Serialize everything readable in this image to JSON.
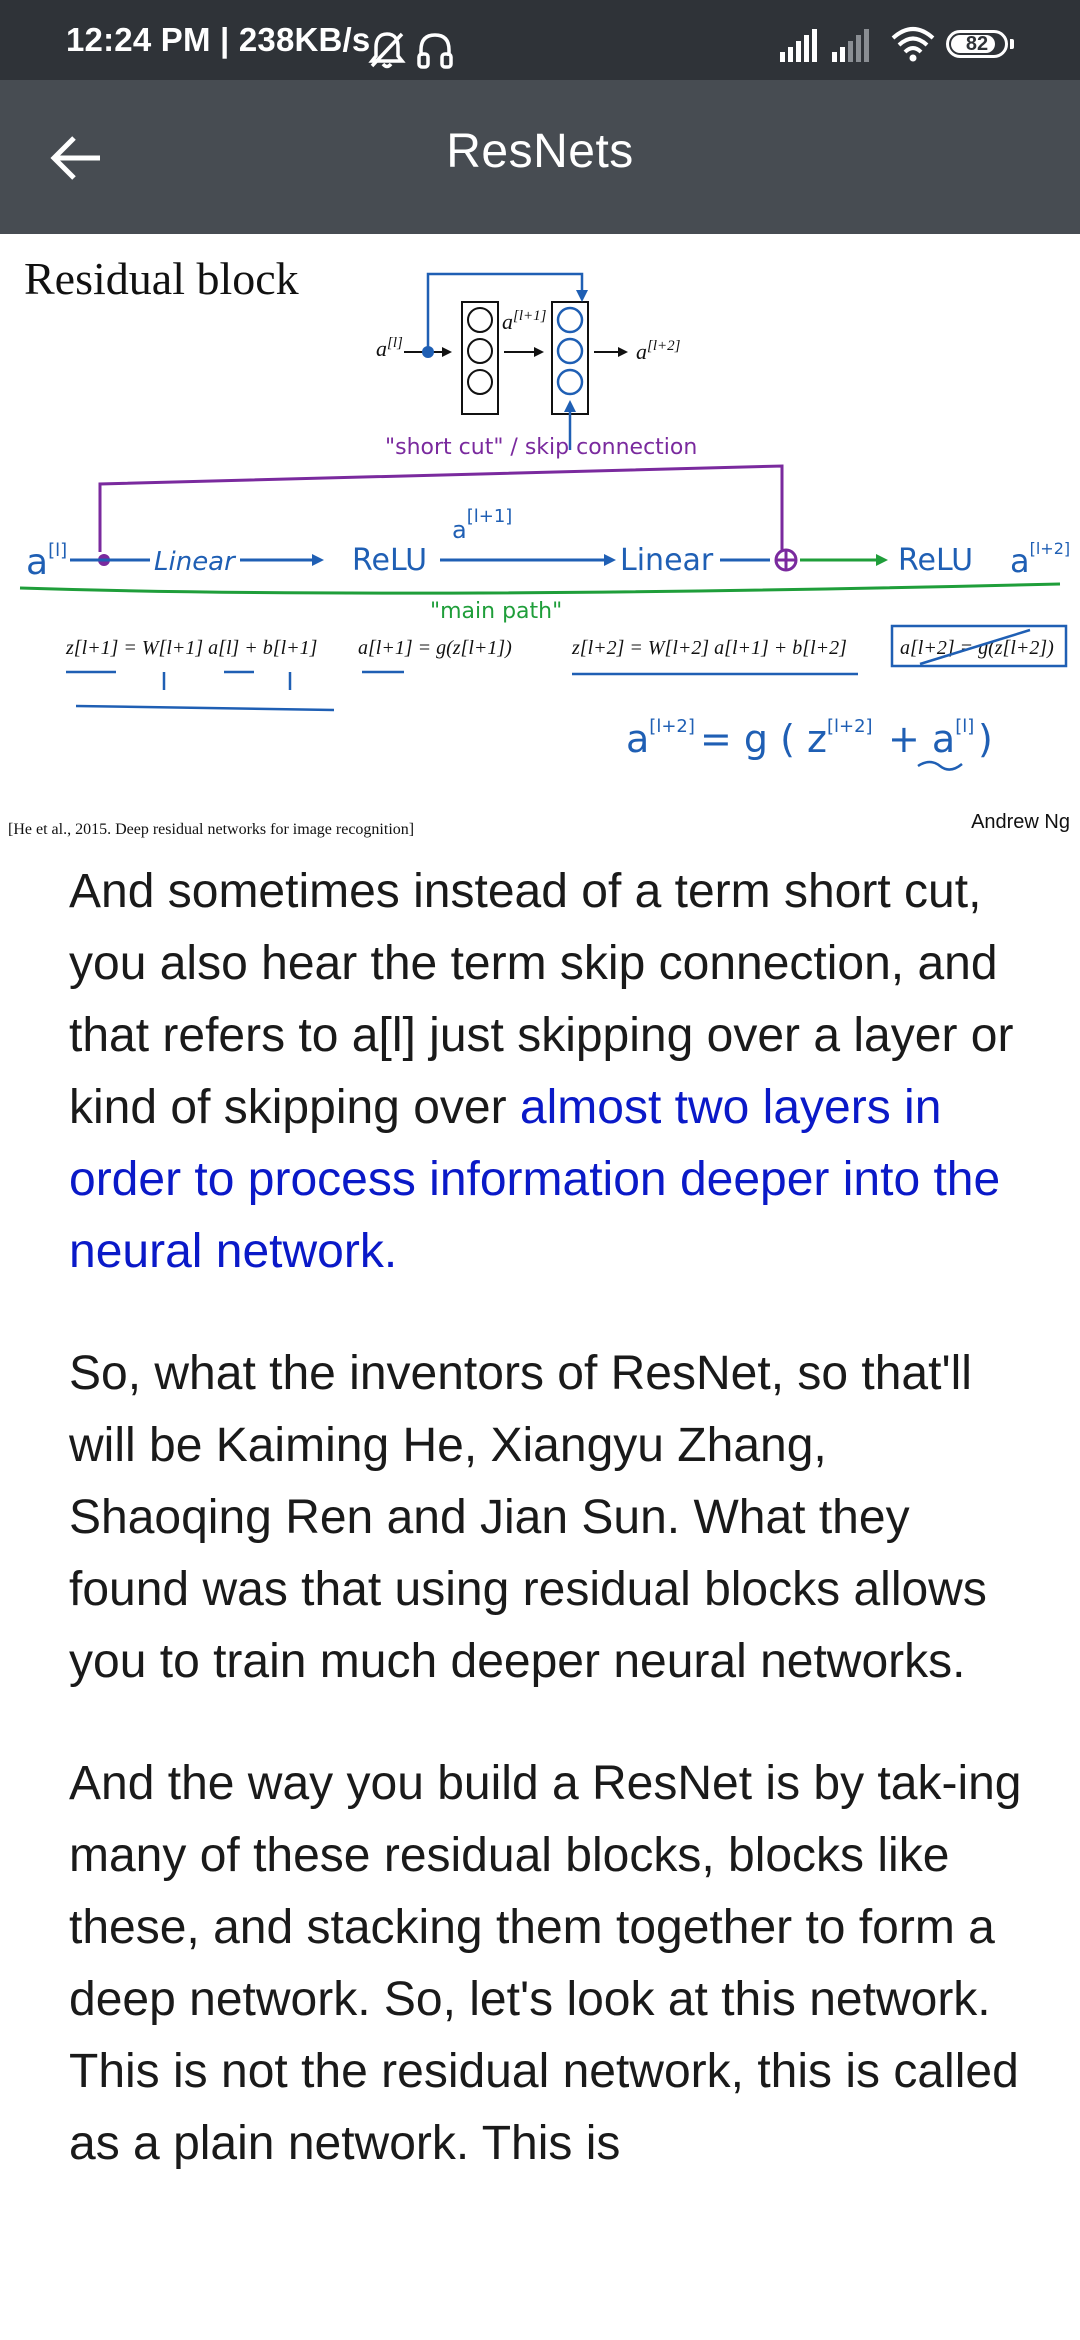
{
  "status_bar": {
    "time": "12:24 PM | 238KB/s",
    "battery": "82",
    "icons": [
      "bell-off-icon",
      "headset-icon",
      "signal-icon",
      "signal-weak-icon",
      "wifi-icon",
      "battery-icon"
    ]
  },
  "app_bar": {
    "back_icon": "arrow-left-icon",
    "title": "ResNets"
  },
  "slide": {
    "title": "Residual block",
    "a_l": "a",
    "a_l_sup": "[l]",
    "a_l1": "a",
    "a_l1_sup": "[l+1]",
    "a_l2": "a",
    "a_l2_sup": "[l+2]",
    "shortcut_label": "\"short cut\" / skip connection",
    "hand_a_in": "a",
    "hand_a_in_sup": "[l]",
    "hand_linear1": "Linear",
    "hand_relu1": "ReLU",
    "hand_a_mid": "a",
    "hand_a_mid_sup": "[l+1]",
    "hand_linear2": "Linear",
    "hand_relu2": "ReLU",
    "hand_a_out": "a",
    "hand_a_out_sup": "[l+2]",
    "main_path_label": "\"main path\"",
    "eq1": "z[l+1] = W[l+1] a[l] + b[l+1]",
    "eq2": "a[l+1] = g(z[l+1])",
    "eq3": "z[l+2] = W[l+2] a[l+1] + b[l+2]",
    "eq4": "a[l+2] = g(z[l+2])",
    "eq_new_lhs": "a",
    "eq_new_lhs_sup": "[l+2]",
    "eq_new_rhs": "= g ( z",
    "eq_new_rhs_sup": "[l+2]",
    "eq_new_plus": "+  a",
    "eq_new_plus_sup": "[l]",
    "eq_new_close": ")",
    "citation": "[He et al., 2015. Deep residual networks for image recognition]",
    "author": "Andrew Ng"
  },
  "article": {
    "p1_text": "And sometimes instead of a term short cut, you also hear the term skip connection, and that refers to a[l] just skipping over a layer or kind of skipping over ",
    "p1_highlight": "almost two layers in order to process information deeper into the neural network.",
    "p2": "So, what the inventors of ResNet, so that'll will be Kaiming He, Xiangyu Zhang, Shaoqing Ren and Jian Sun. What they found was that using residual blocks allows you to train much deeper neural networks.",
    "p3": "And the way you build a ResNet is by tak-ing many of these residual blocks, blocks like these, and stacking them together to form a deep network. So, let's look at this network. This is not the residual network, this is called as a plain network. This is"
  },
  "colors": {
    "status_bar": "#2f3338",
    "app_bar": "#474c52",
    "highlight": "#0a19c8",
    "ink_blue": "#1f5fb4",
    "ink_purple": "#7a2a9e",
    "ink_green": "#1f9e3a"
  }
}
